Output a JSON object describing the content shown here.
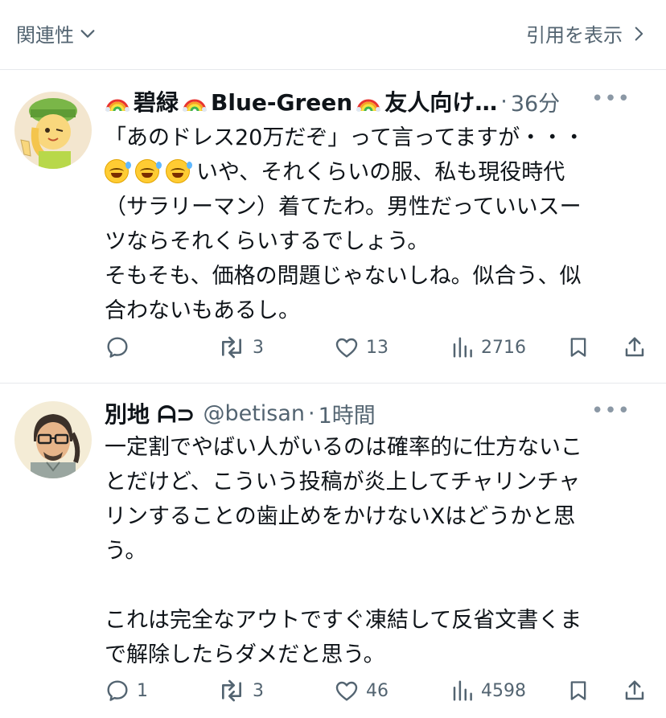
{
  "topbar": {
    "relevance_label": "関連性",
    "quote_link_label": "引用を表示"
  },
  "tweets": [
    {
      "name_parts": [
        "碧緑",
        "Blue-Green",
        "友人向け…"
      ],
      "sep": "·",
      "time": "36分",
      "lines": [
        "「あのドレス20万だぞ」って言ってますが・・・",
        "いや、それくらいの服、私も現役時代",
        "（サラリーマン）着てたわ。男性だっていいスー",
        "ツならそれくらいするでしょう。",
        "そもそも、価格の問題じゃないしね。似合う、似",
        "合わないもあるし。"
      ],
      "actions": {
        "replies": "",
        "reposts": "3",
        "likes": "13",
        "views": "2716"
      }
    },
    {
      "name": "別地 ᗩ⊃",
      "handle": "@betisan",
      "sep": "·",
      "time": "1時間",
      "lines": [
        "一定割でやばい人がいるのは確率的に仕方ないこ",
        "とだけど、こういう投稿が炎上してチャリンチャ",
        "リンすることの歯止めをかけないXはどうかと思",
        "う。",
        "",
        "これは完全なアウトですぐ凍結して反省文書くま",
        "で解除したらダメだと思う。"
      ],
      "actions": {
        "replies": "1",
        "reposts": "3",
        "likes": "46",
        "views": "4598"
      }
    }
  ]
}
